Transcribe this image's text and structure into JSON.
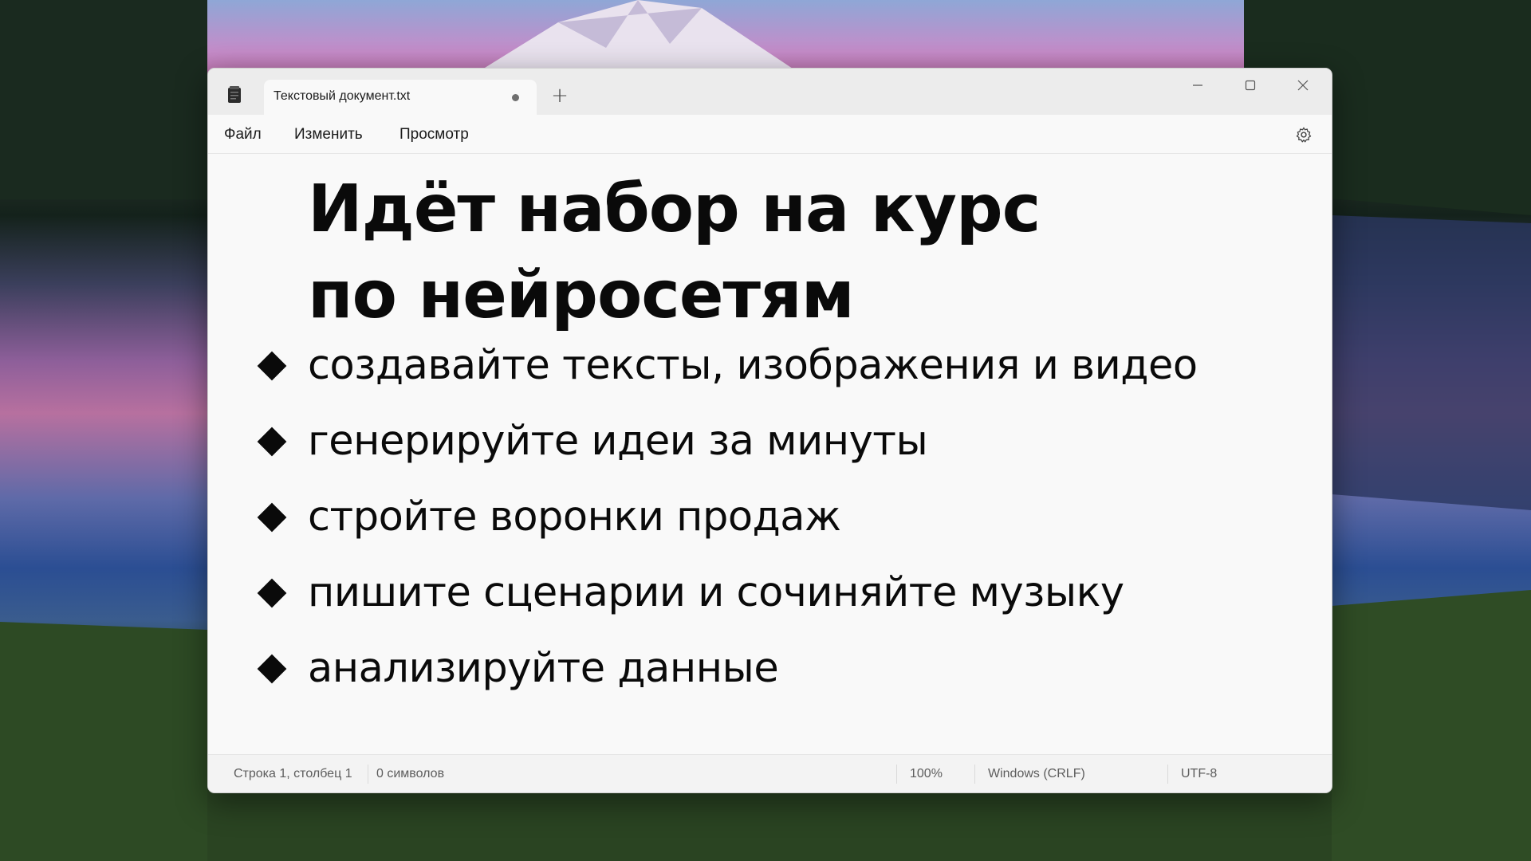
{
  "window": {
    "tab_title": "Текстовый документ.txt",
    "new_tab_symbol": "+"
  },
  "menu": {
    "file": "Файл",
    "edit": "Изменить",
    "view": "Просмотр"
  },
  "document": {
    "headline_line1": "Идёт набор на курс",
    "headline_line2": "по нейросетям",
    "bullets": [
      "создавайте тексты, изображения и видео",
      "генерируйте идеи за минуты",
      "стройте воронки продаж",
      "пишите сценарии и сочиняйте музыку",
      "анализируйте данные"
    ]
  },
  "status": {
    "position": "Строка 1, столбец 1",
    "chars": "0 символов",
    "zoom": "100%",
    "line_ending": "Windows (CRLF)",
    "encoding": "UTF-8"
  },
  "icons": {
    "app": "notepad-icon",
    "settings": "gear-icon",
    "minimize": "minimize-icon",
    "maximize": "maximize-icon",
    "close": "close-icon",
    "bullet": "diamond-icon"
  },
  "colors": {
    "text": "#0a0a0a",
    "window_bg": "#f9f9f9",
    "titlebar_bg": "#ececec"
  }
}
